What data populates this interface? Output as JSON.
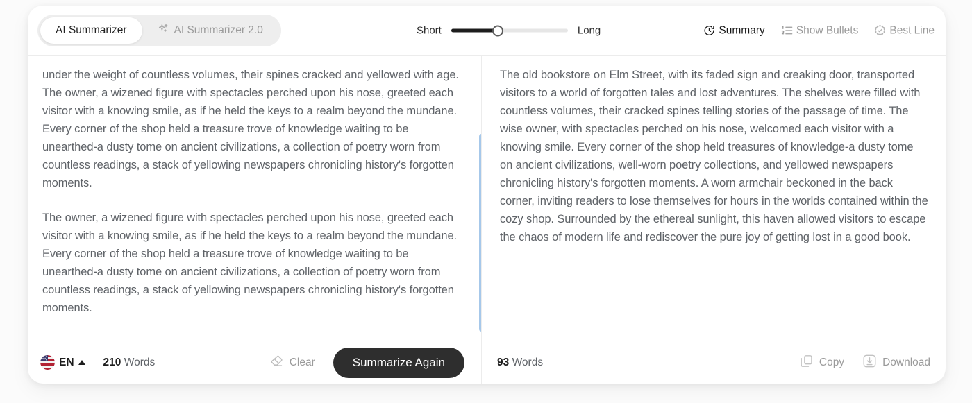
{
  "tabs": [
    {
      "id": "ai-summarizer",
      "label": "AI Summarizer",
      "active": true,
      "icon": ""
    },
    {
      "id": "ai-summarizer-20",
      "label": "AI Summarizer 2.0",
      "active": false,
      "icon": "sparkles-icon"
    }
  ],
  "length_slider": {
    "min_label": "Short",
    "max_label": "Long",
    "value_percent": 40
  },
  "toolbar_actions": [
    {
      "id": "summary",
      "label": "Summary",
      "icon": "history-clock-icon",
      "active": true
    },
    {
      "id": "show-bullets",
      "label": "Show Bullets",
      "icon": "numbered-list-icon",
      "active": false
    },
    {
      "id": "best-line",
      "label": "Best Line",
      "icon": "badge-check-icon",
      "active": false
    }
  ],
  "source_panel": {
    "paragraphs": [
      "under the weight of countless volumes, their spines cracked and yellowed with age.\nThe owner, a wizened figure with spectacles perched upon his nose, greeted each visitor with a knowing smile, as if he held the keys to a realm beyond the mundane. Every corner of the shop held a treasure trove of knowledge waiting to be unearthed-a dusty tome on ancient civilizations, a collection of poetry worn from countless readings, a stack of yellowing newspapers chronicling history's forgotten moments.",
      "The owner, a wizened figure with spectacles perched upon his nose, greeted each visitor with a knowing smile, as if he held the keys to a realm beyond the mundane. Every corner of the shop held a treasure trove of knowledge waiting to be unearthed-a dusty tome on ancient civilizations, a collection of poetry worn from countless readings, a stack of yellowing newspapers chronicling history's forgotten moments."
    ],
    "footer": {
      "language_code": "EN",
      "language_icon": "us-flag-icon",
      "word_count_number": "210",
      "word_count_label": "Words",
      "clear_label": "Clear",
      "clear_icon": "eraser-icon",
      "primary_label": "Summarize Again"
    }
  },
  "summary_panel": {
    "paragraphs": [
      "The old bookstore on Elm Street, with its faded sign and creaking door, transported visitors to a world of forgotten tales and lost adventures. The shelves were filled with countless volumes, their cracked spines telling stories of the passage of time. The wise owner, with spectacles perched on his nose, welcomed each visitor with a knowing smile. Every corner of the shop held treasures of knowledge-a dusty tome on ancient civilizations, well-worn poetry collections, and yellowed newspapers chronicling history's forgotten moments. A worn armchair beckoned in the back corner, inviting readers to lose themselves for hours in the worlds contained within the cozy shop. Surrounded by the ethereal sunlight, this haven allowed visitors to escape the chaos of modern life and rediscover the pure joy of getting lost in a good book."
    ],
    "footer": {
      "word_count_number": "93",
      "word_count_label": "Words",
      "copy_label": "Copy",
      "copy_icon": "copy-icon",
      "download_label": "Download",
      "download_icon": "download-icon"
    }
  },
  "colors": {
    "accent_dark": "#2e2e2e",
    "scrollbar_blue": "#a6c8ea",
    "text_muted": "#9a9a9a",
    "body_text": "#5f6368",
    "segment_bg": "#eeeeee"
  }
}
